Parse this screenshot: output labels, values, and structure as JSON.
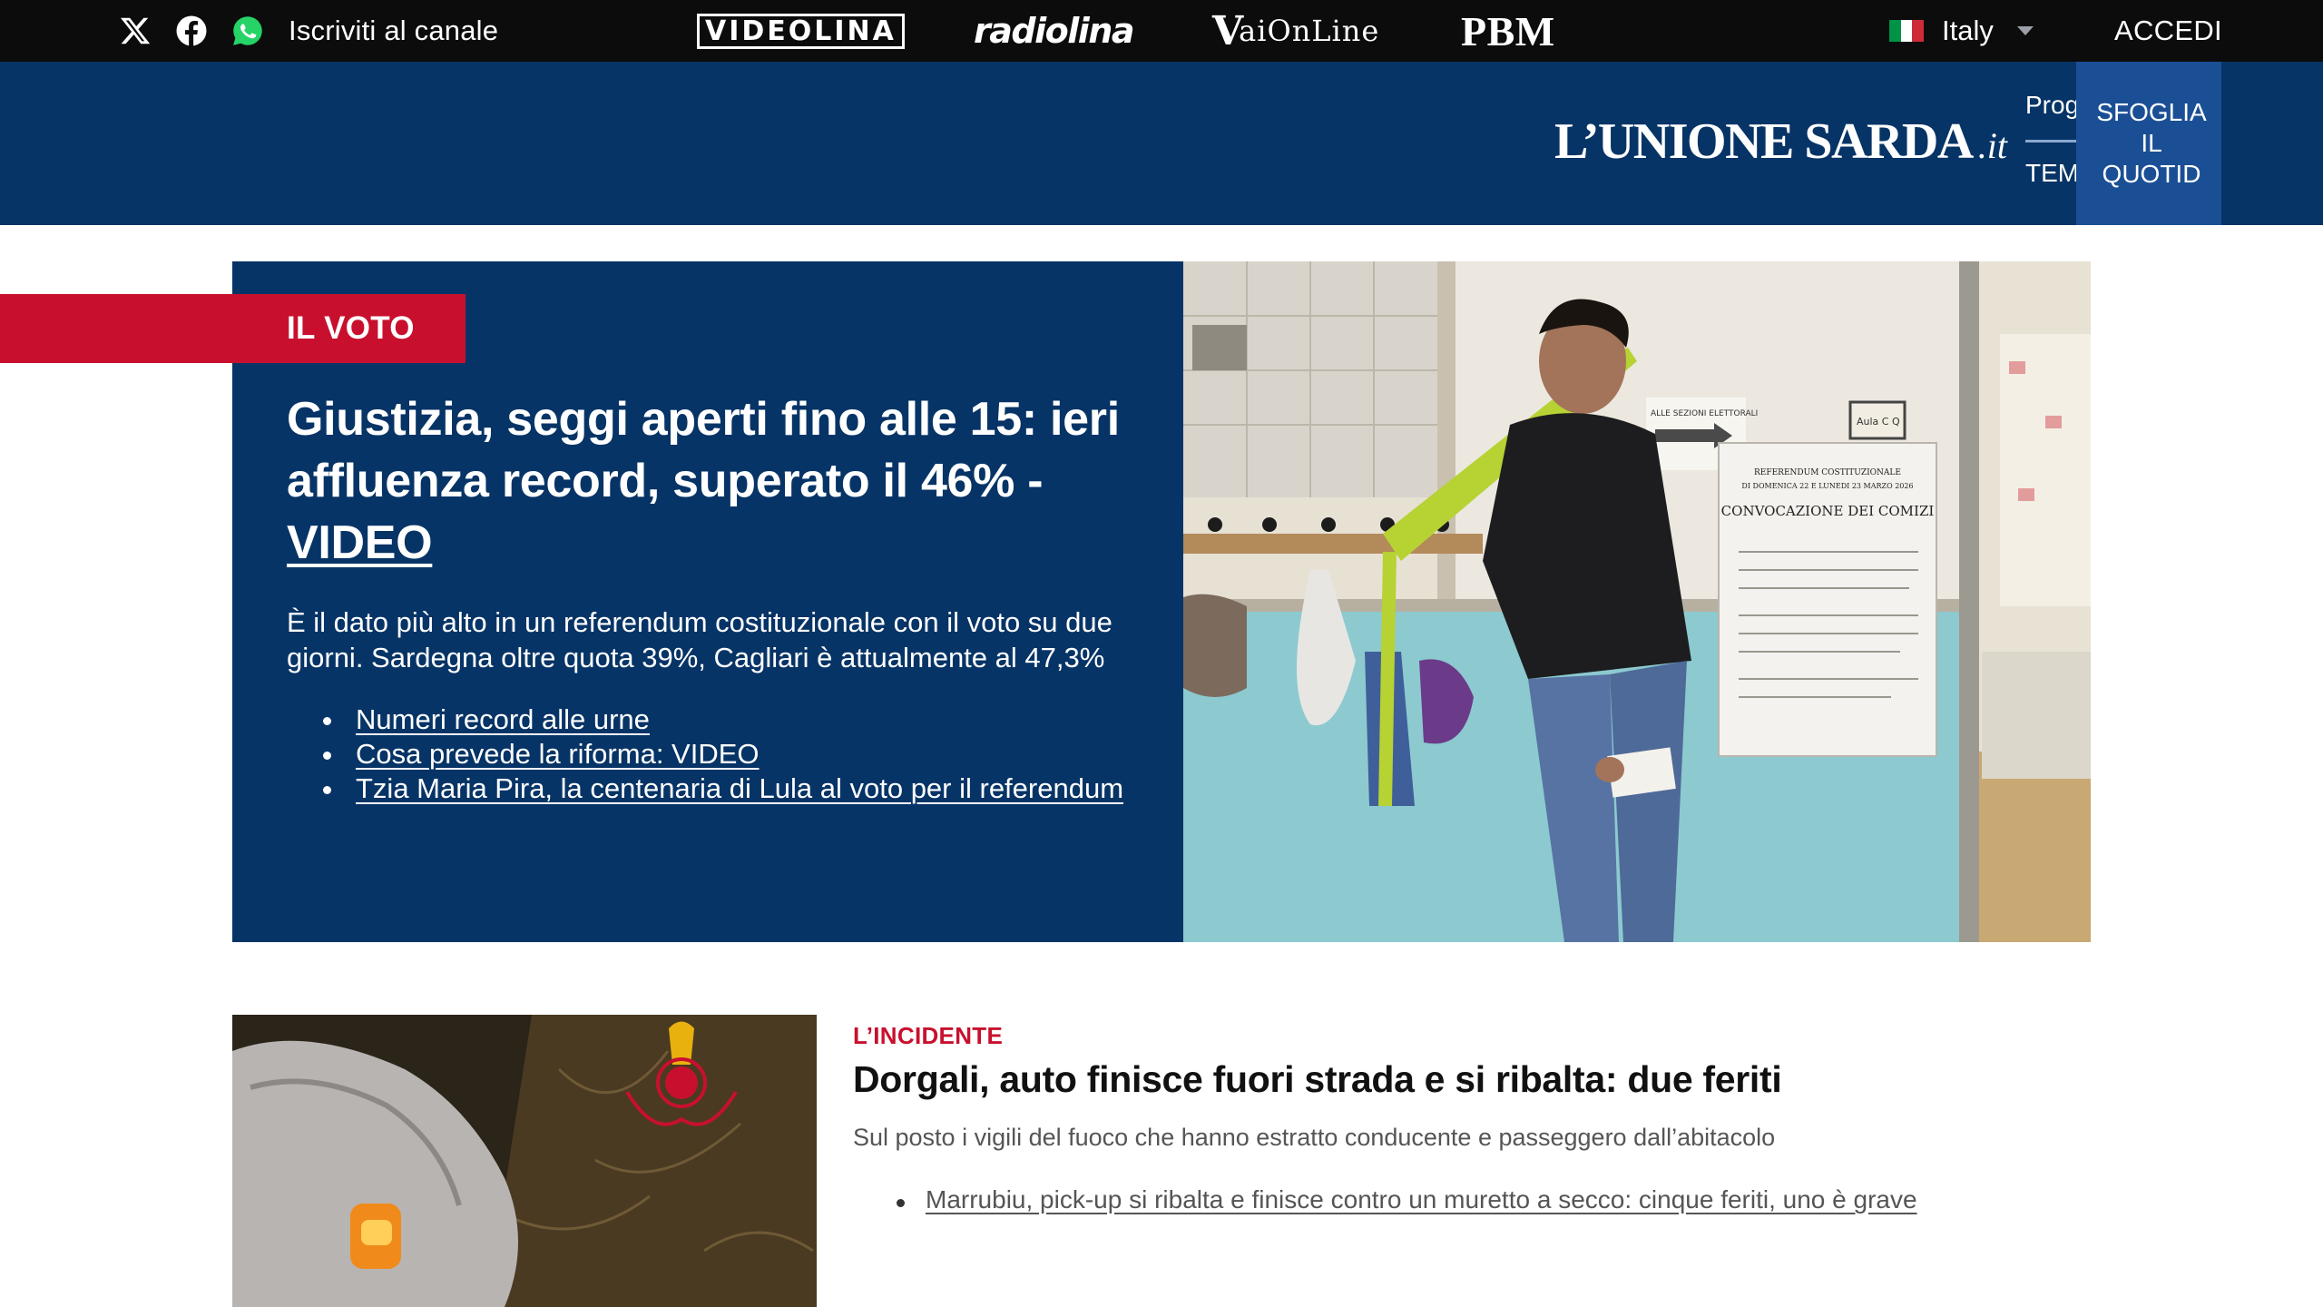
{
  "topbar": {
    "social": [
      {
        "name": "x-icon"
      },
      {
        "name": "facebook-icon"
      },
      {
        "name": "whatsapp-icon"
      }
    ],
    "channel_label": "Iscriviti al canale",
    "brands": {
      "videolina": "VIDEOLINA",
      "radiolina": "radiolina",
      "vaionline_v": "V",
      "vaionline_rest": "aiOnLine",
      "pbm": "PBM"
    },
    "region": {
      "label": "Italy",
      "flag_colors": [
        "#009246",
        "#ffffff",
        "#ce2b37"
      ]
    },
    "login_label": "ACCEDI"
  },
  "header": {
    "logo_main": "L’UNIONE SARDA",
    "logo_suffix": ".it",
    "nav_items": [
      "Prog",
      "TEM"
    ],
    "browse_label": "SFOGLIA\nIL\nQUOTID",
    "background": "#073466"
  },
  "hero": {
    "kicker": "IL VOTO",
    "headline": "Giustizia, seggi aperti fino alle 15: ieri affluenza record, superato il 46% -",
    "headline_link": "VIDEO",
    "summary": "È il dato più alto in un referendum costituzionale con il voto su due giorni. Sardegna oltre quota 39%, Cagliari è attualmente al 47,3%",
    "related": [
      "Numeri record alle urne",
      "Cosa prevede la riforma: VIDEO",
      "Tzia Maria Pira, la centenaria di Lula al voto per il referendum"
    ],
    "photo_texts": {
      "sign_title": "REFERENDUM COSTITUZIONALE",
      "sign_date": "DI DOMENICA 22 E LUNEDI 23 MARZO 2026",
      "sign_heading": "CONVOCAZIONE DEI COMIZI",
      "label_sections": "ALLE SEZIONI ELETTORALI",
      "label_room": "Aula C Q"
    },
    "accent_color": "#c8102e"
  },
  "story2": {
    "kicker": "L’INCIDENTE",
    "title": "Dorgali, auto finisce fuori strada e si ribalta: due feriti",
    "summary": "Sul posto i vigili del fuoco che hanno estratto conducente e passeggero dall’abitacolo",
    "related": [
      "Marrubiu, pick-up si ribalta e finisce contro un muretto a secco: cinque feriti, uno è grave"
    ]
  }
}
